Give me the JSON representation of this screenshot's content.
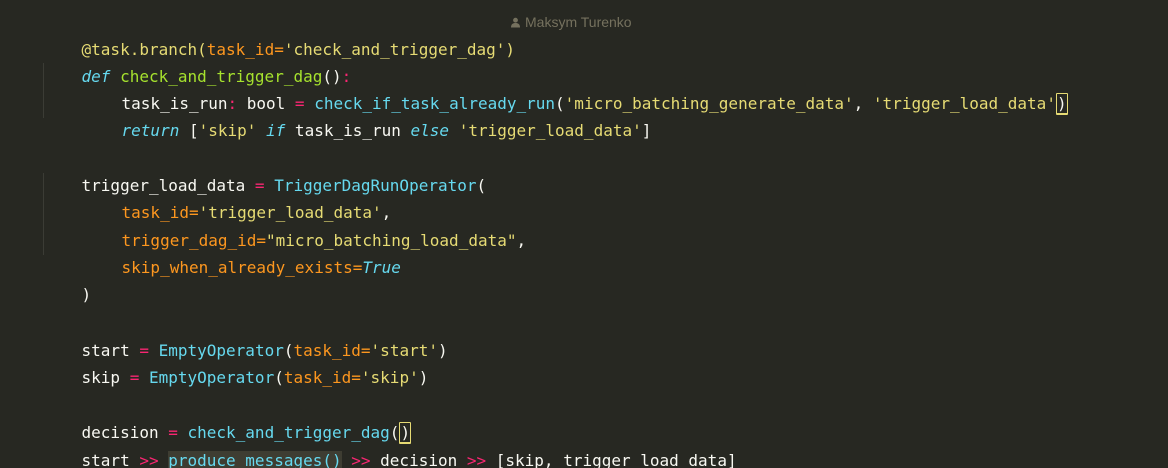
{
  "author_annotation": {
    "icon": "person-icon",
    "name": "Maksym Turenko"
  },
  "code": {
    "line1": {
      "decorator": "@task.branch(",
      "param": "task_id=",
      "value": "'check_and_trigger_dag'",
      "close": ")"
    },
    "line2": {
      "kw": "def ",
      "fn": "check_and_trigger_dag",
      "paren": "()",
      "colon": ":"
    },
    "line3": {
      "var": "task_is_run",
      "colon": ": ",
      "type": "bool",
      "eq": " = ",
      "call": "check_if_task_already_run",
      "open": "(",
      "arg1": "'micro_batching_generate_data'",
      "comma": ", ",
      "arg2": "'trigger_load_data'",
      "close": ")"
    },
    "line4": {
      "kw_return": "return",
      "sp1": " [",
      "str": "'skip'",
      "sp2": " ",
      "kw_if": "if",
      "mid": " task_is_run ",
      "kw_else": "else",
      "sp3": " ",
      "str2": "'trigger_load_data'",
      "close": "]"
    },
    "line6": {
      "var": "trigger_load_data",
      "eq": " = ",
      "call": "TriggerDagRunOperator",
      "open": "("
    },
    "line7": {
      "param": "task_id=",
      "value": "'trigger_load_data'",
      "comma": ","
    },
    "line8": {
      "param": "trigger_dag_id=",
      "value": "\"micro_batching_load_data\"",
      "comma": ","
    },
    "line9": {
      "param": "skip_when_already_exists=",
      "value": "True"
    },
    "line10": {
      "close": ")"
    },
    "line12": {
      "var": "start",
      "eq": " = ",
      "call": "EmptyOperator",
      "open": "(",
      "param": "task_id=",
      "value": "'start'",
      "close": ")"
    },
    "line13": {
      "var": "skip",
      "eq": " = ",
      "call": "EmptyOperator",
      "open": "(",
      "param": "task_id=",
      "value": "'skip'",
      "close": ")"
    },
    "line15": {
      "var": "decision",
      "eq": " = ",
      "call": "check_and_trigger_dag",
      "paren_open": "(",
      "paren_close": ")"
    },
    "line16": {
      "start": "start ",
      "op1": ">>",
      "sp1": " ",
      "usage": "produce_messages()",
      "sp2": " ",
      "op2": ">>",
      "mid": " decision ",
      "op3": ">>",
      "rest": " [skip, trigger_load_data]"
    }
  }
}
